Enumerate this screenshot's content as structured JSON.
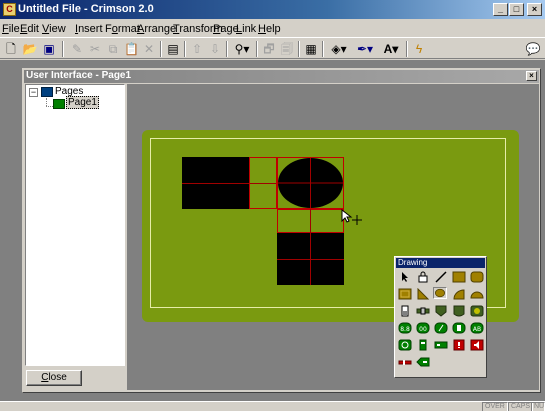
{
  "app": {
    "title": "Untitled File - Crimson 2.0"
  },
  "menu": {
    "items": [
      {
        "pre": "",
        "u": "F",
        "post": "ile"
      },
      {
        "pre": "",
        "u": "E",
        "post": "dit"
      },
      {
        "pre": "",
        "u": "V",
        "post": "iew"
      },
      {
        "pre": "",
        "u": "I",
        "post": "nsert"
      },
      {
        "pre": "F",
        "u": "o",
        "post": "rmat"
      },
      {
        "pre": "",
        "u": "A",
        "post": "rrange"
      },
      {
        "pre": "",
        "u": "T",
        "post": "ransform"
      },
      {
        "pre": "",
        "u": "P",
        "post": "age"
      },
      {
        "pre": "",
        "u": "L",
        "post": "ink"
      },
      {
        "pre": "",
        "u": "H",
        "post": "elp"
      }
    ]
  },
  "toolbar": {
    "icons": [
      "new-icon",
      "open-icon",
      "save-icon",
      "pencil-icon",
      "cut-icon",
      "copy-icon",
      "paste-icon",
      "delete-icon",
      "screen-icon",
      "up-icon",
      "down-icon",
      "zoom-icon",
      "properties-icon",
      "edit-icon",
      "grid-icon",
      "fill-color-icon",
      "line-color-icon",
      "font-color-icon",
      "lightning-icon",
      "chat-icon"
    ]
  },
  "child_window": {
    "title": "User Interface - Page1"
  },
  "tree": {
    "root": {
      "label": "Pages",
      "expander": "−"
    },
    "child": {
      "label": "Page1"
    }
  },
  "close_button": {
    "pre": "",
    "u": "C",
    "post": "lose"
  },
  "palette": {
    "title": "Drawing",
    "tools": [
      [
        "pointer",
        "lock",
        "line",
        "rectangle",
        "rounded-rectangle"
      ],
      [
        "bevel-rect",
        "triangle",
        "ellipse",
        "quarter-ellipse",
        "semi-ellipse"
      ],
      [
        "tank",
        "pipe",
        "valve",
        "cylinder",
        "gauge"
      ],
      [
        "digital-display",
        "numeric",
        "analog",
        "bar",
        "alarm"
      ],
      [
        "clock",
        "indicator",
        "led",
        "warning",
        "speaker"
      ],
      [
        "slider",
        "tag"
      ]
    ]
  },
  "status": {
    "over": "OVER",
    "caps": "CAPS",
    "num": "NUM"
  },
  "colors": {
    "panel": "#7a9a10",
    "panel_border": "#e6eda8",
    "selection": "#c00000",
    "title_active": "#0a246a"
  }
}
